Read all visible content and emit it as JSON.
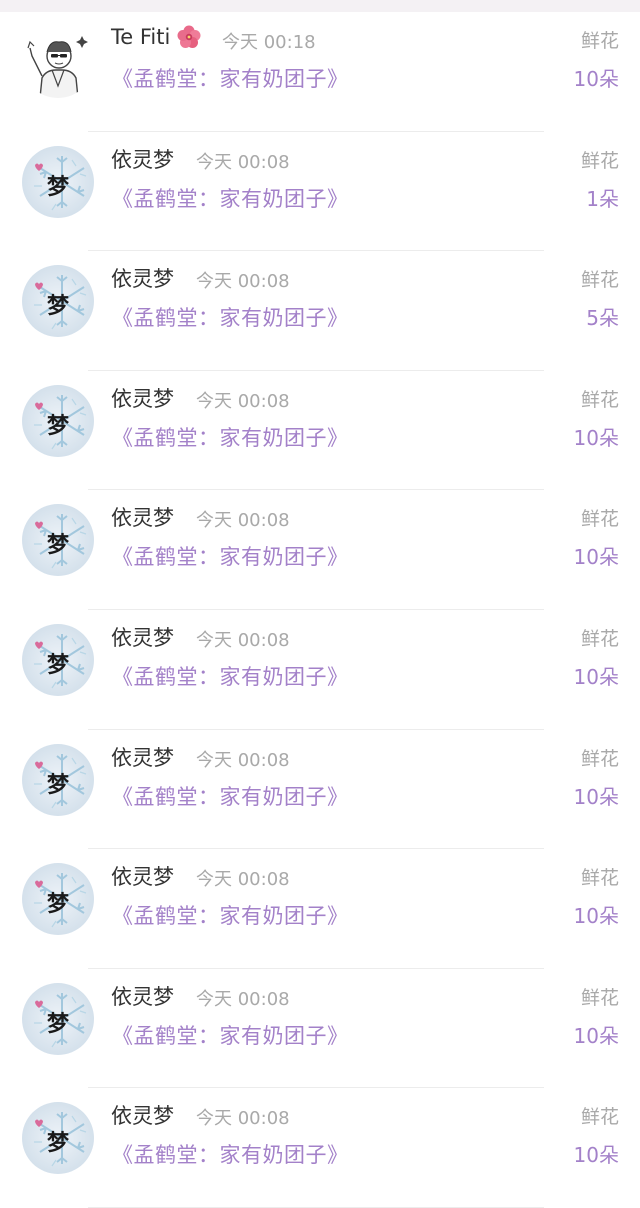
{
  "colors": {
    "name": "#333333",
    "time": "#a9a9a9",
    "book": "#a381c9",
    "amount": "#a381c9",
    "gift": "#a9a9a9"
  },
  "records": [
    {
      "user": "Te Fiti",
      "badge_icon": "hibiscus-flower-icon",
      "avatar": "sketch-character-avatar",
      "time": "今天 00:18",
      "book": "《孟鹤堂：家有奶团子》",
      "gift": "鲜花",
      "amount": "10朵"
    },
    {
      "user": "依灵梦",
      "avatar": "snowflake-meng-avatar",
      "avatar_char": "梦",
      "time": "今天 00:08",
      "book": "《孟鹤堂：家有奶团子》",
      "gift": "鲜花",
      "amount": "1朵"
    },
    {
      "user": "依灵梦",
      "avatar": "snowflake-meng-avatar",
      "avatar_char": "梦",
      "time": "今天 00:08",
      "book": "《孟鹤堂：家有奶团子》",
      "gift": "鲜花",
      "amount": "5朵"
    },
    {
      "user": "依灵梦",
      "avatar": "snowflake-meng-avatar",
      "avatar_char": "梦",
      "time": "今天 00:08",
      "book": "《孟鹤堂：家有奶团子》",
      "gift": "鲜花",
      "amount": "10朵"
    },
    {
      "user": "依灵梦",
      "avatar": "snowflake-meng-avatar",
      "avatar_char": "梦",
      "time": "今天 00:08",
      "book": "《孟鹤堂：家有奶团子》",
      "gift": "鲜花",
      "amount": "10朵"
    },
    {
      "user": "依灵梦",
      "avatar": "snowflake-meng-avatar",
      "avatar_char": "梦",
      "time": "今天 00:08",
      "book": "《孟鹤堂：家有奶团子》",
      "gift": "鲜花",
      "amount": "10朵"
    },
    {
      "user": "依灵梦",
      "avatar": "snowflake-meng-avatar",
      "avatar_char": "梦",
      "time": "今天 00:08",
      "book": "《孟鹤堂：家有奶团子》",
      "gift": "鲜花",
      "amount": "10朵"
    },
    {
      "user": "依灵梦",
      "avatar": "snowflake-meng-avatar",
      "avatar_char": "梦",
      "time": "今天 00:08",
      "book": "《孟鹤堂：家有奶团子》",
      "gift": "鲜花",
      "amount": "10朵"
    },
    {
      "user": "依灵梦",
      "avatar": "snowflake-meng-avatar",
      "avatar_char": "梦",
      "time": "今天 00:08",
      "book": "《孟鹤堂：家有奶团子》",
      "gift": "鲜花",
      "amount": "10朵"
    },
    {
      "user": "依灵梦",
      "avatar": "snowflake-meng-avatar",
      "avatar_char": "梦",
      "time": "今天 00:08",
      "book": "《孟鹤堂：家有奶团子》",
      "gift": "鲜花",
      "amount": "10朵"
    }
  ]
}
